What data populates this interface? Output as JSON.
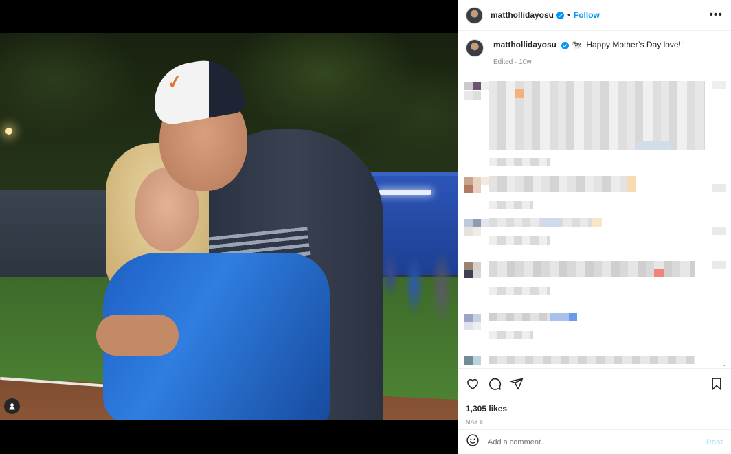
{
  "post": {
    "username": "matthollidayosu",
    "follow_label": "Follow",
    "more_label": "•••",
    "separator": "•"
  },
  "caption": {
    "username": "matthollidayosu",
    "text": "🐄. Happy Mother’s Day love!!",
    "meta": "Edited · 10w"
  },
  "engagement": {
    "likes": "1,305 likes",
    "date": "MAY 8"
  },
  "comment_input": {
    "placeholder": "Add a comment...",
    "post_label": "Post"
  },
  "colors": {
    "accent": "#0095f6",
    "muted": "#8e8e8e",
    "post_disabled": "#b2dffc"
  },
  "icons": [
    "heart-icon",
    "comment-icon",
    "share-icon",
    "bookmark-icon",
    "emoji-icon",
    "user-tag-icon",
    "verified-badge-icon"
  ]
}
